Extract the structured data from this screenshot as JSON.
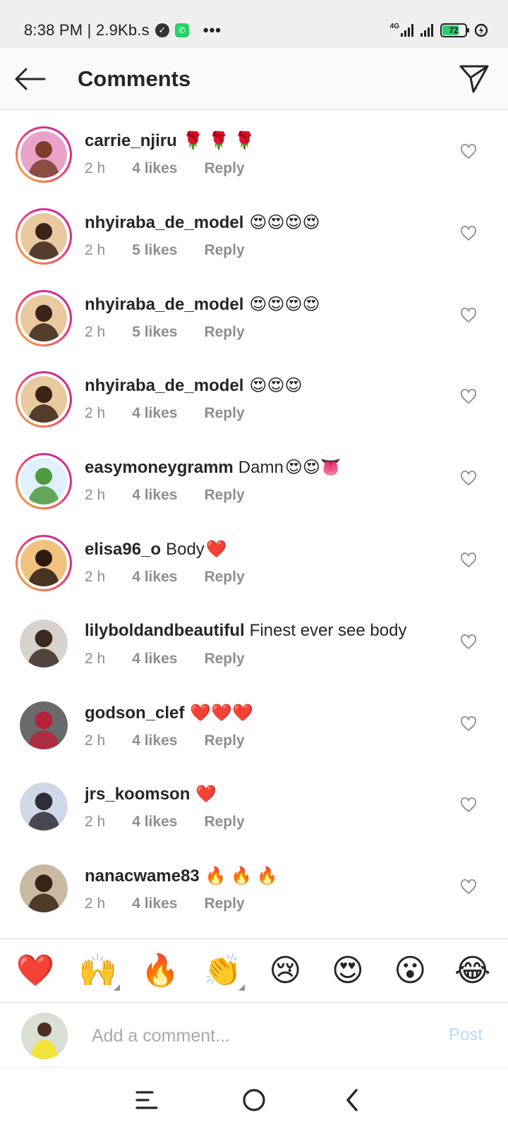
{
  "status_bar": {
    "time": "8:38 PM | 2.9Kb.s",
    "network_label": "4G",
    "battery": "72",
    "battery_level": 0.72,
    "icons": [
      "verified-check-icon",
      "whatsapp-icon",
      "more-dots-icon",
      "signal-icon",
      "signal-icon",
      "battery-icon",
      "charging-icon"
    ]
  },
  "header": {
    "title": "Comments",
    "back_icon": "arrow-left-icon",
    "action_icon": "send-paper-plane-icon"
  },
  "comments": [
    {
      "username": "carrie_njiru",
      "text": "",
      "emoji": "🌹 🌹 🌹",
      "time": "2 h",
      "likes": "4 likes",
      "reply": "Reply",
      "story_ring": true,
      "avatar_colors": [
        "#e9a3c9",
        "#7b3f2a"
      ]
    },
    {
      "username": "nhyiraba_de_model",
      "text": "",
      "emoji": "😍😍😍😍",
      "time": "2 h",
      "likes": "5 likes",
      "reply": "Reply",
      "story_ring": true,
      "avatar_colors": [
        "#e8c9a0",
        "#3a2418"
      ]
    },
    {
      "username": "nhyiraba_de_model",
      "text": "",
      "emoji": "😍😍😍😍",
      "time": "2 h",
      "likes": "5 likes",
      "reply": "Reply",
      "story_ring": true,
      "avatar_colors": [
        "#e8c9a0",
        "#3a2418"
      ]
    },
    {
      "username": "nhyiraba_de_model",
      "text": "",
      "emoji": "😍😍😍",
      "time": "2 h",
      "likes": "4 likes",
      "reply": "Reply",
      "story_ring": true,
      "avatar_colors": [
        "#e8c9a0",
        "#3a2418"
      ]
    },
    {
      "username": "easymoneygramm",
      "text": "Damn",
      "emoji": "😍😍👅",
      "time": "2 h",
      "likes": "4 likes",
      "reply": "Reply",
      "story_ring": true,
      "avatar_colors": [
        "#dff0ff",
        "#4f9a3c"
      ]
    },
    {
      "username": "elisa96_o",
      "text": "Body",
      "emoji": "❤️",
      "time": "2 h",
      "likes": "4 likes",
      "reply": "Reply",
      "story_ring": true,
      "avatar_colors": [
        "#f1c27d",
        "#2b1a12"
      ]
    },
    {
      "username": "lilyboldandbeautiful",
      "text": "Finest ever see body",
      "emoji": "",
      "time": "2 h",
      "likes": "4 likes",
      "reply": "Reply",
      "story_ring": false,
      "avatar_colors": [
        "#d8d2cc",
        "#3b2a22"
      ]
    },
    {
      "username": "godson_clef",
      "text": "",
      "emoji": "❤️❤️❤️",
      "time": "2 h",
      "likes": "4 likes",
      "reply": "Reply",
      "story_ring": false,
      "avatar_colors": [
        "#6a6a6a",
        "#b7223a"
      ]
    },
    {
      "username": "jrs_koomson",
      "text": "",
      "emoji": "❤️",
      "time": "2 h",
      "likes": "4 likes",
      "reply": "Reply",
      "story_ring": false,
      "avatar_colors": [
        "#cfd8e8",
        "#2f2f3a"
      ]
    },
    {
      "username": "nanacwame83",
      "text": "",
      "emoji": "🔥 🔥 🔥",
      "time": "2 h",
      "likes": "4 likes",
      "reply": "Reply",
      "story_ring": false,
      "avatar_colors": [
        "#c9b9a3",
        "#3a2418"
      ]
    }
  ],
  "emoji_bar": [
    {
      "emoji": "❤️",
      "has_variants": false
    },
    {
      "emoji": "🙌",
      "has_variants": true
    },
    {
      "emoji": "🔥",
      "has_variants": false
    },
    {
      "emoji": "👏",
      "has_variants": true
    },
    {
      "emoji": "😢",
      "has_variants": false
    },
    {
      "emoji": "😍",
      "has_variants": false
    },
    {
      "emoji": "😮",
      "has_variants": false
    },
    {
      "emoji": "😂",
      "has_variants": false
    }
  ],
  "composer": {
    "placeholder": "Add a comment...",
    "value": "",
    "post_label": "Post",
    "avatar_colors": [
      "#f3e23a",
      "#4a3020"
    ]
  },
  "nav_bar": {
    "icons": [
      "menu-recents-icon",
      "home-circle-icon",
      "back-chevron-icon"
    ]
  },
  "colors": {
    "heart_outline": "#8e8e8e",
    "meta_text": "#8e8e8e",
    "post_disabled": "#b3dbff",
    "ring_start": "#f9b233",
    "ring_end": "#b32eb0"
  }
}
